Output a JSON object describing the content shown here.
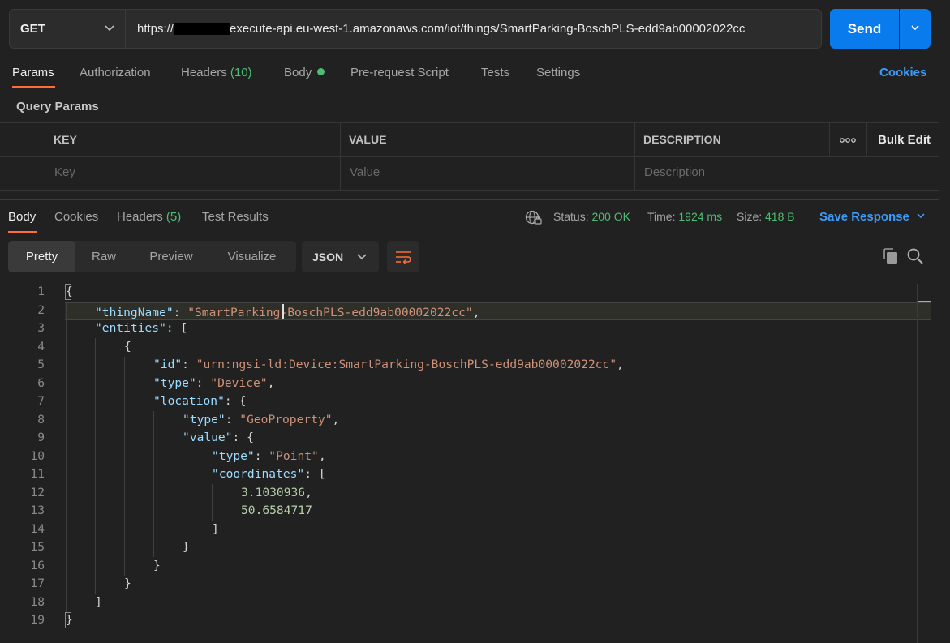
{
  "request": {
    "method": "GET",
    "url_prefix": "https://",
    "url_rest": "execute-api.eu-west-1.amazonaws.com/iot/things/SmartParking-BoschPLS-edd9ab00002022cc",
    "send_label": "Send"
  },
  "request_tabs": {
    "params": "Params",
    "authorization": "Authorization",
    "headers": "Headers",
    "headers_count": "(10)",
    "body": "Body",
    "pre_request": "Pre-request Script",
    "tests": "Tests",
    "settings": "Settings",
    "cookies": "Cookies"
  },
  "query_params": {
    "title": "Query Params",
    "columns": [
      "KEY",
      "VALUE",
      "DESCRIPTION"
    ],
    "more": "ooo",
    "bulk_edit": "Bulk Edit",
    "placeholders": {
      "key": "Key",
      "value": "Value",
      "description": "Description"
    }
  },
  "response_tabs": {
    "body": "Body",
    "cookies": "Cookies",
    "headers": "Headers",
    "headers_count": "(5)",
    "test_results": "Test Results"
  },
  "response_meta": {
    "status_label": "Status:",
    "status_value": "200 OK",
    "time_label": "Time:",
    "time_value": "1924 ms",
    "size_label": "Size:",
    "size_value": "418 B",
    "save_response": "Save Response"
  },
  "view_modes": [
    "Pretty",
    "Raw",
    "Preview",
    "Visualize"
  ],
  "format": "JSON",
  "code_lines": [
    {
      "n": "1"
    },
    {
      "n": "2"
    },
    {
      "n": "3"
    },
    {
      "n": "4"
    },
    {
      "n": "5"
    },
    {
      "n": "6"
    },
    {
      "n": "7"
    },
    {
      "n": "8"
    },
    {
      "n": "9"
    },
    {
      "n": "10"
    },
    {
      "n": "11"
    },
    {
      "n": "12"
    },
    {
      "n": "13"
    },
    {
      "n": "14"
    },
    {
      "n": "15"
    },
    {
      "n": "16"
    },
    {
      "n": "17"
    },
    {
      "n": "18"
    },
    {
      "n": "19"
    }
  ],
  "json": {
    "thingName_key": "\"thingName\"",
    "thingName_val": "\"SmartParking-BoschPLS-edd9ab00002022cc\"",
    "entities_key": "\"entities\"",
    "id_key": "\"id\"",
    "id_val": "\"urn:ngsi-ld:Device:SmartParking-BoschPLS-edd9ab00002022cc\"",
    "type_key": "\"type\"",
    "type_val": "\"Device\"",
    "location_key": "\"location\"",
    "geo_val": "\"GeoProperty\"",
    "value_key": "\"value\"",
    "point_val": "\"Point\"",
    "coordinates_key": "\"coordinates\"",
    "coord_1": "3.1030936",
    "coord_2": "50.6584717"
  }
}
